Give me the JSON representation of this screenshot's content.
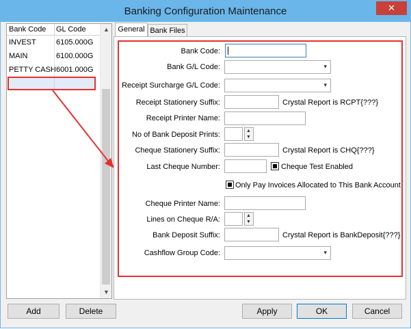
{
  "window": {
    "title": "Banking Configuration Maintenance",
    "close_glyph": "✕"
  },
  "list": {
    "columns": [
      "Bank Code",
      "GL Code"
    ],
    "rows": [
      {
        "bank_code": "INVEST",
        "gl_code": "6105.000G"
      },
      {
        "bank_code": "MAIN",
        "gl_code": "6100.000G"
      },
      {
        "bank_code": "PETTY CASH",
        "gl_code": "6001.000G"
      }
    ],
    "scroll_up": "▲",
    "scroll_down": "▼"
  },
  "tabs": [
    {
      "label": "General"
    },
    {
      "label": "Bank Files"
    }
  ],
  "form": {
    "bank_code": {
      "label": "Bank Code:",
      "value": ""
    },
    "bank_gl_code": {
      "label": "Bank G/L Code:",
      "value": ""
    },
    "receipt_surcharge_gl_code": {
      "label": "Receipt Surcharge G/L Code:",
      "value": ""
    },
    "receipt_stationery_suffix": {
      "label": "Receipt Stationery Suffix:",
      "value": "",
      "note": "Crystal Report is RCPT{???}"
    },
    "receipt_printer_name": {
      "label": "Receipt Printer Name:",
      "value": ""
    },
    "no_of_bank_deposit_prints": {
      "label": "No of Bank Deposit Prints:",
      "value": ""
    },
    "cheque_stationery_suffix": {
      "label": "Cheque Stationery Suffix:",
      "value": "",
      "note": "Crystal Report is CHQ{???}"
    },
    "last_cheque_number": {
      "label": "Last Cheque Number:",
      "value": ""
    },
    "cheque_test_enabled": {
      "label": "Cheque Test Enabled",
      "checked": true
    },
    "only_pay_allocated": {
      "label": "Only Pay Invoices Allocated to This Bank Account",
      "checked": true
    },
    "cheque_printer_name": {
      "label": "Cheque Printer Name:",
      "value": ""
    },
    "lines_on_cheque_ra": {
      "label": "Lines on Cheque R/A:",
      "value": ""
    },
    "bank_deposit_suffix": {
      "label": "Bank Deposit Suffix:",
      "value": "",
      "note": "Crystal Report is BankDeposit{???}"
    },
    "cashflow_group_code": {
      "label": "Cashflow Group Code:",
      "value": ""
    }
  },
  "icons": {
    "combo_arrow": "▾",
    "spin_up": "▲",
    "spin_down": "▼"
  },
  "buttons": {
    "add": "Add",
    "delete": "Delete",
    "apply": "Apply",
    "ok": "OK",
    "cancel": "Cancel"
  },
  "colors": {
    "title_bar": "#6ab6ea",
    "highlight": "#e53030",
    "close": "#c7403a"
  }
}
